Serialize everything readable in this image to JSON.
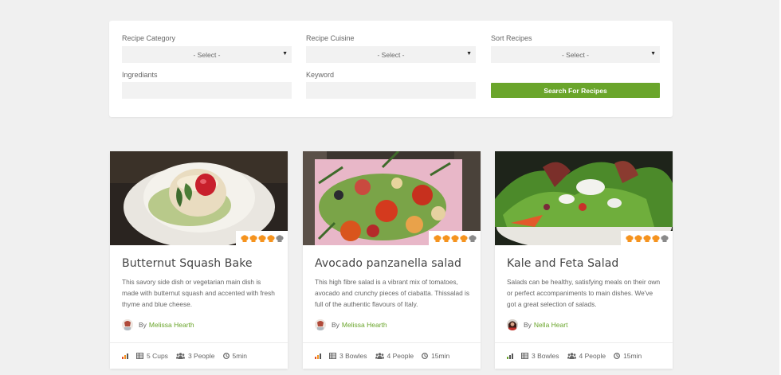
{
  "search": {
    "category_label": "Recipe Category",
    "category_value": "- Select -",
    "cuisine_label": "Recipe Cuisine",
    "cuisine_value": "- Select -",
    "sort_label": "Sort Recipes",
    "sort_value": "- Select -",
    "ingredients_label": "Ingrediants",
    "ingredients_value": "",
    "keyword_label": "Keyword",
    "keyword_value": "",
    "button_label": "Search For Recipes"
  },
  "colors": {
    "accent": "#6aa52b",
    "rating": "#f5931e",
    "rating_empty": "#8a8a8a"
  },
  "recipes": [
    {
      "title": "Butternut Squash Bake",
      "description": "This savory side dish or vegetarian main dish is made with butternut squash and accented with fresh thyme and blue cheese.",
      "author_prefix": "By",
      "author": "Melissa Hearth",
      "rating": 4,
      "rating_max": 5,
      "yield": "5 Cups",
      "servings": "3 People",
      "time": "5min"
    },
    {
      "title": "Avocado panzanella salad",
      "description": "This high fibre salad is a vibrant mix of tomatoes, avocado and crunchy pieces of ciabatta. Thissalad is full of the authentic flavours of Italy.",
      "author_prefix": "By",
      "author": "Melissa Hearth",
      "rating": 4,
      "rating_max": 5,
      "yield": "3 Bowles",
      "servings": "4 People",
      "time": "15min"
    },
    {
      "title": "Kale and Feta Salad",
      "description": "Salads can be healthy, satisfying meals on their own or perfect accompaniments to main dishes. We've got a great selection of salads.",
      "author_prefix": "By",
      "author": "Nella Heart",
      "rating": 4,
      "rating_max": 5,
      "yield": "3 Bowles",
      "servings": "4 People",
      "time": "15min"
    }
  ]
}
